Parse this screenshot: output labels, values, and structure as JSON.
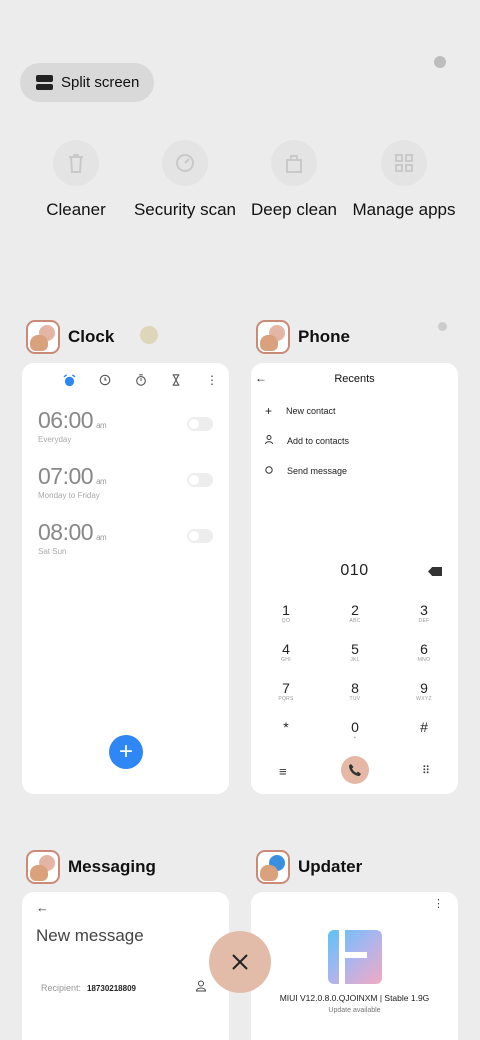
{
  "split_screen": {
    "label": "Split screen",
    "icon": "split-screen-icon"
  },
  "tools": [
    {
      "label": "Cleaner",
      "icon": "trash-icon"
    },
    {
      "label": "Security scan",
      "icon": "security-scan-icon"
    },
    {
      "label": "Deep clean",
      "icon": "deep-clean-icon"
    },
    {
      "label": "Manage apps",
      "icon": "grid-icon"
    }
  ],
  "clock": {
    "app_name": "Clock",
    "alarms": [
      {
        "time": "06:00",
        "ampm": "am",
        "repeat": "Everyday"
      },
      {
        "time": "07:00",
        "ampm": "am",
        "repeat": "Monday to Friday"
      },
      {
        "time": "08:00",
        "ampm": "am",
        "repeat": "Sat Sun"
      }
    ],
    "fab": "+"
  },
  "phone": {
    "app_name": "Phone",
    "title": "Recents",
    "actions": [
      "New contact",
      "Add to contacts",
      "Send message"
    ],
    "number": "010",
    "keys": [
      {
        "digit": "1",
        "letters": "QO"
      },
      {
        "digit": "2",
        "letters": "ABC"
      },
      {
        "digit": "3",
        "letters": "DEF"
      },
      {
        "digit": "4",
        "letters": "GHI"
      },
      {
        "digit": "5",
        "letters": "JKL"
      },
      {
        "digit": "6",
        "letters": "MNO"
      },
      {
        "digit": "7",
        "letters": "PQRS"
      },
      {
        "digit": "8",
        "letters": "TUV"
      },
      {
        "digit": "9",
        "letters": "WXYZ"
      },
      {
        "digit": "*",
        "letters": ""
      },
      {
        "digit": "0",
        "letters": "+"
      },
      {
        "digit": "#",
        "letters": ""
      }
    ],
    "menu_glyph": "≡",
    "dialpad_glyph": "⠿"
  },
  "messaging": {
    "app_name": "Messaging",
    "title": "New message",
    "recipient_label": "Recipient:",
    "recipient_value": "18730218809"
  },
  "updater": {
    "app_name": "Updater",
    "version": "MIUI V12.0.8.0.QJOINXM | Stable 1.9G",
    "status": "Update available"
  },
  "close_all": {
    "icon": "close-icon"
  },
  "colors": {
    "accent_blue": "#2f86f5",
    "peach": "#e2bca9",
    "background": "#ececec"
  }
}
